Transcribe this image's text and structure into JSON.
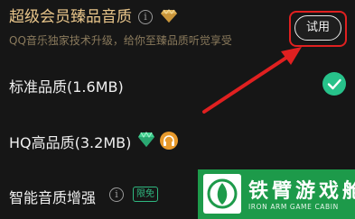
{
  "premium": {
    "title": "超级会员臻品音质",
    "subtitle": "QQ音乐独家技术升级，给你至臻品质听觉享受",
    "trial_label": "试用"
  },
  "options": [
    {
      "label": "标准品质(1.6MB)",
      "selected": true
    },
    {
      "label": "HQ高品质(3.2MB)",
      "selected": false
    },
    {
      "label": "智能音质增强",
      "badge": "限免",
      "selected": false
    }
  ],
  "watermark": {
    "title": "铁臂游戏舱",
    "subtitle": "IRON ARM GAME CABIN"
  },
  "colors": {
    "background": "#161616",
    "premium_gold": "#e8c58a",
    "check_green": "#27c28a",
    "annotation_red": "#e02020",
    "watermark_green": "#1d9a4a"
  }
}
